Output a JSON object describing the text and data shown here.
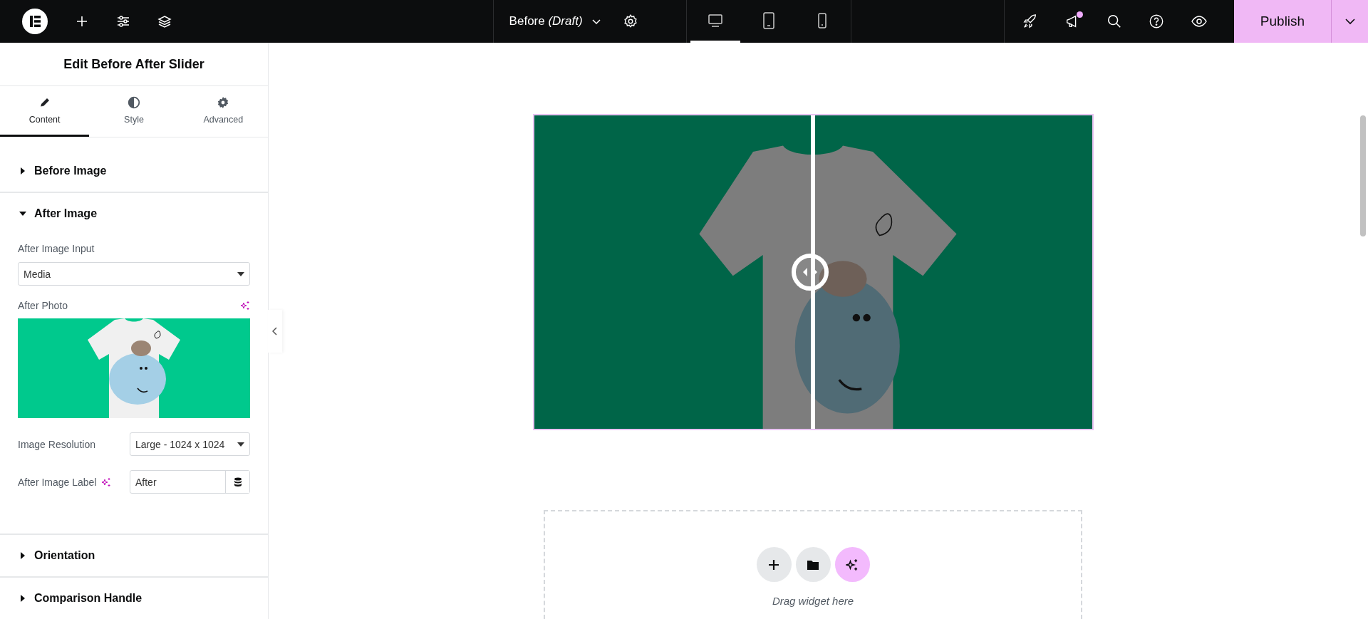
{
  "topbar": {
    "document_title": "Before *(Draft)*",
    "devices": [
      {
        "kind": "desktop",
        "selected": true
      },
      {
        "kind": "tablet",
        "selected": false
      },
      {
        "kind": "mobile",
        "selected": false
      }
    ],
    "notification_unread": true,
    "publish_label": "Publish"
  },
  "panel": {
    "title": "Edit Before After Slider",
    "tabs": [
      {
        "label": "Content",
        "kind": "content",
        "selected": true
      },
      {
        "label": "Style",
        "kind": "style",
        "selected": false
      },
      {
        "label": "Advanced",
        "kind": "advanced",
        "selected": false
      }
    ],
    "sections": [
      {
        "title": "Before Image",
        "expanded": false
      },
      {
        "title": "After Image",
        "expanded": true,
        "controls": [
          {
            "kind": "select",
            "label": "After Image Input",
            "value": "Media",
            "ai": false
          },
          {
            "kind": "media",
            "label": "After Photo",
            "ai": true
          },
          {
            "kind": "inline-select",
            "label": "Image Resolution",
            "value": "Large - 1024 x 1024",
            "ai": false
          },
          {
            "kind": "inline-text",
            "label": "After Image Label",
            "value": "After",
            "ai": true
          }
        ]
      },
      {
        "title": "Orientation",
        "expanded": false
      },
      {
        "title": "Comparison Handle",
        "expanded": false
      }
    ]
  },
  "canvas": {
    "slider": {
      "level": 0.5
    },
    "drop_zone": {
      "hint": "Drag widget here"
    }
  }
}
